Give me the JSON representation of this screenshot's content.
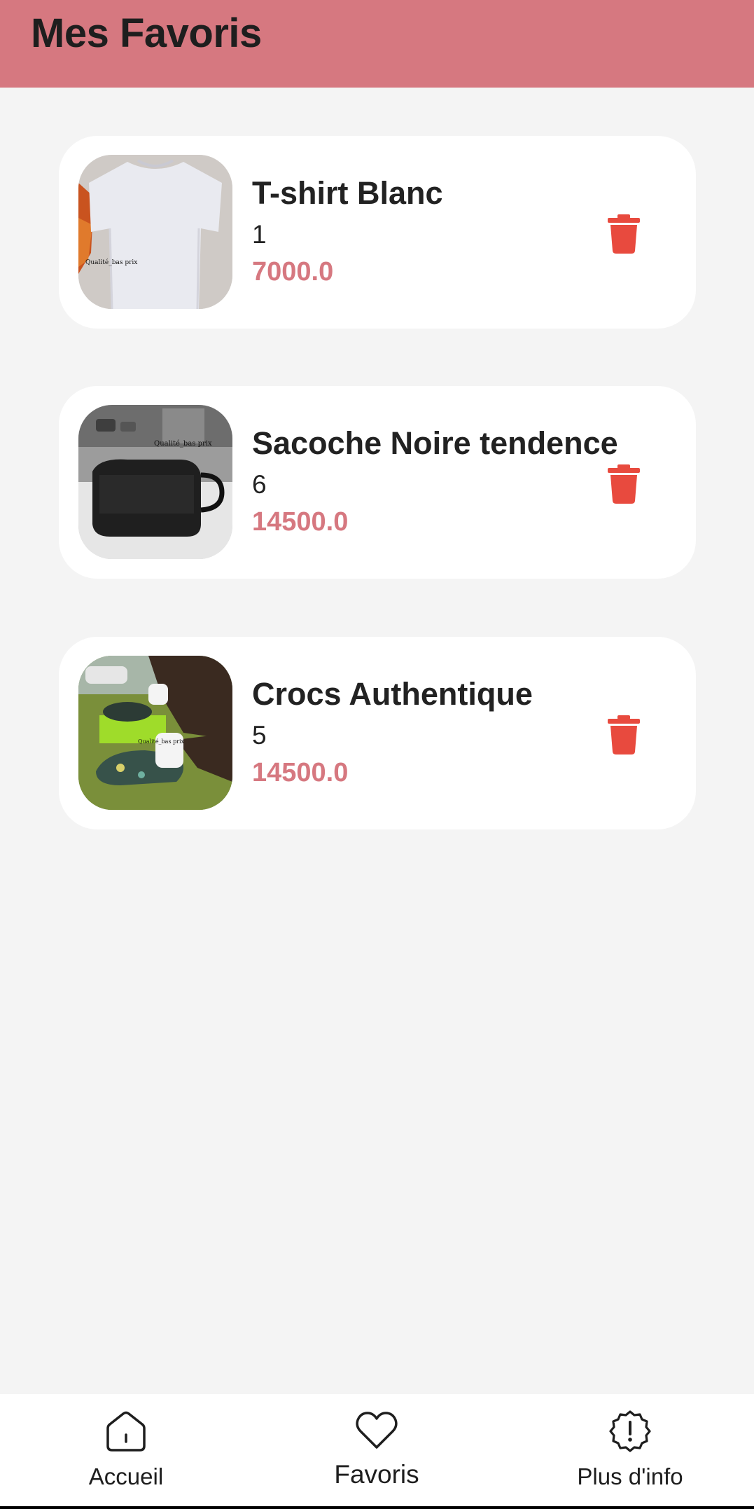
{
  "header": {
    "title": "Mes Favoris"
  },
  "favorites": [
    {
      "name": "T-shirt Blanc",
      "quantity": "1",
      "price": "7000.0",
      "image_caption": "Qualité_bas prix"
    },
    {
      "name": "Sacoche Noire tendence",
      "quantity": "6",
      "price": "14500.0",
      "image_caption": "Qualité_bas prix"
    },
    {
      "name": "Crocs Authentique",
      "quantity": "5",
      "price": "14500.0",
      "image_caption": "Qualité_bas prix"
    }
  ],
  "bottom_nav": [
    {
      "label": "Accueil",
      "icon": "home-icon",
      "active": false
    },
    {
      "label": "Favoris",
      "icon": "heart-icon",
      "active": true
    },
    {
      "label": "Plus d'info",
      "icon": "info-badge-icon",
      "active": false
    }
  ],
  "colors": {
    "header_bg": "#d67880",
    "price": "#d67880",
    "delete": "#e84a3e",
    "background": "#f4f4f4"
  }
}
